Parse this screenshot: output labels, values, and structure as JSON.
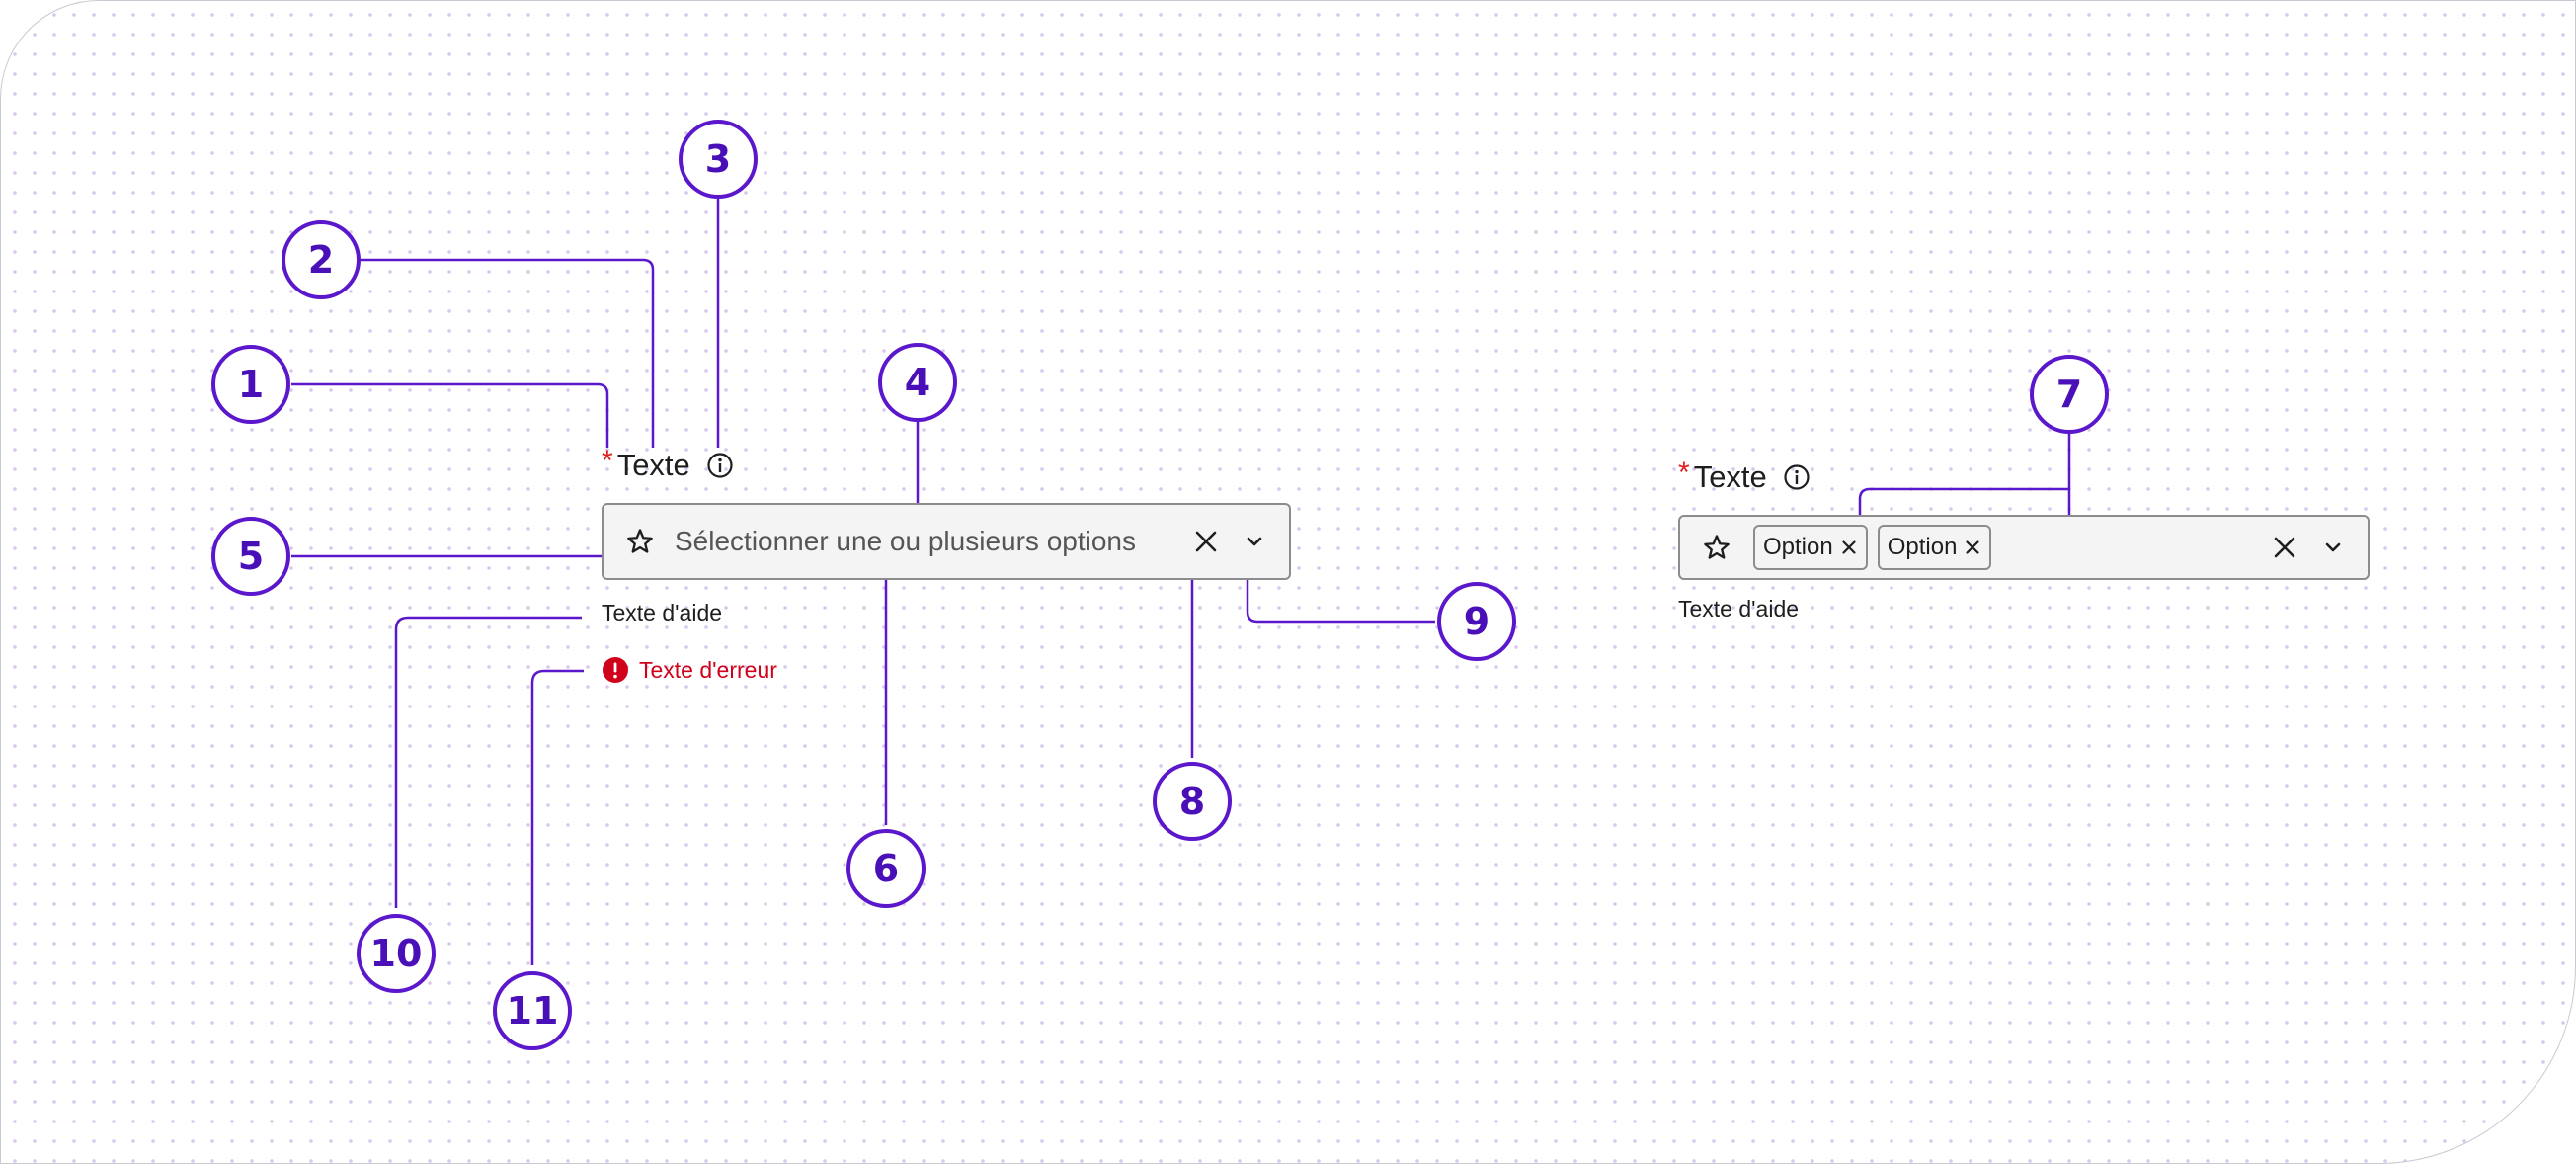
{
  "colors": {
    "accent": "#5a17cc",
    "callout_text": "#4a10b8",
    "required": "#e02020",
    "error": "#d0021b",
    "field_border": "#8c8c8c",
    "field_background": "#f4f4f4"
  },
  "icons": {
    "leading": "star-icon",
    "label_info": "info-icon",
    "clear": "close-icon",
    "expand": "chevron-down-icon",
    "chip_remove": "close-icon",
    "error": "error-icon"
  },
  "callouts": [
    "1",
    "2",
    "3",
    "4",
    "5",
    "6",
    "7",
    "8",
    "9",
    "10",
    "11"
  ],
  "field_empty": {
    "required_mark": "*",
    "label": "Texte",
    "placeholder": "Sélectionner une ou plusieurs options",
    "help_text": "Texte d'aide",
    "error_text": "Texte d'erreur"
  },
  "field_filled": {
    "required_mark": "*",
    "label": "Texte",
    "chips": [
      {
        "label": "Option"
      },
      {
        "label": "Option"
      }
    ],
    "help_text": "Texte d'aide"
  }
}
